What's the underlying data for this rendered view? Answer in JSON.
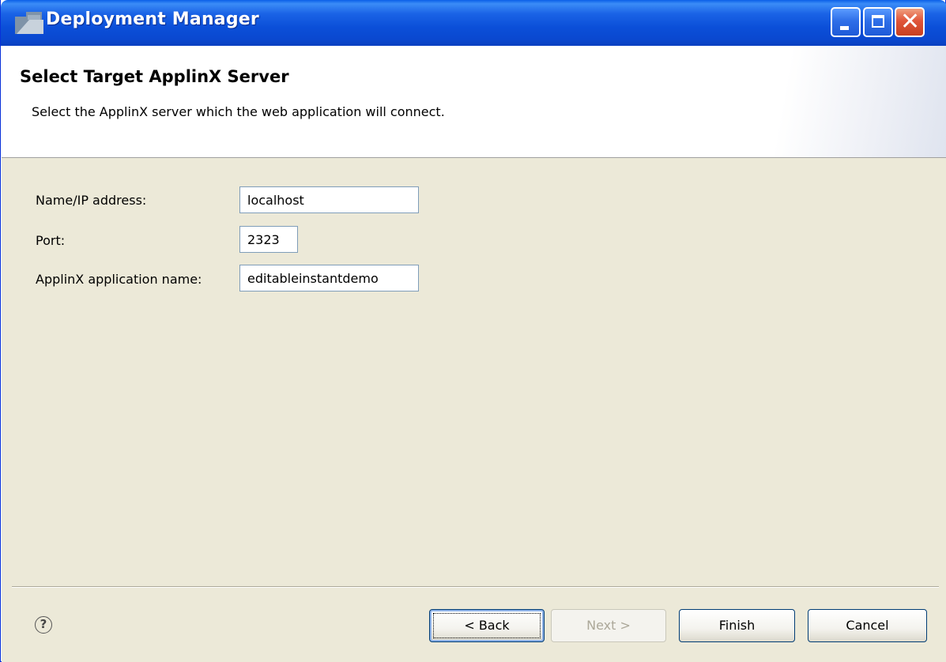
{
  "window": {
    "title": "Deployment Manager"
  },
  "header": {
    "title": "Select Target ApplinX Server",
    "description": "Select the ApplinX server which the web application will connect."
  },
  "form": {
    "name_label": "Name/IP address:",
    "name_value": "localhost",
    "port_label": "Port:",
    "port_value": "2323",
    "app_label": "ApplinX application name:",
    "app_value": "editableinstantdemo"
  },
  "buttons": {
    "back": "< Back",
    "next": "Next >",
    "finish": "Finish",
    "cancel": "Cancel"
  },
  "help_icon": "help-icon"
}
